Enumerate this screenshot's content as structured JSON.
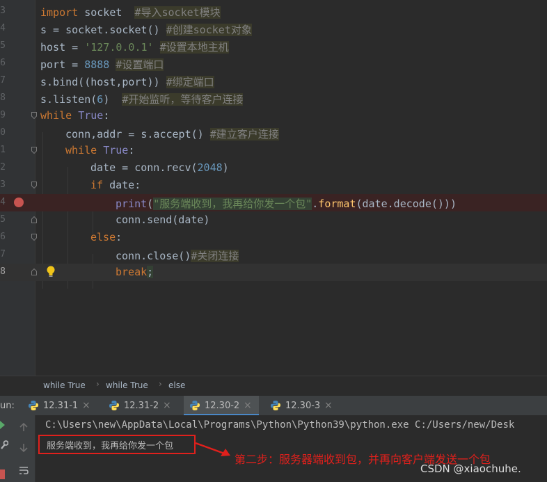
{
  "editor": {
    "lines": [
      {
        "num": "3"
      },
      {
        "num": "4"
      },
      {
        "num": "5"
      },
      {
        "num": "6"
      },
      {
        "num": "7"
      },
      {
        "num": "8"
      },
      {
        "num": "9"
      },
      {
        "num": "0"
      },
      {
        "num": "1"
      },
      {
        "num": "2"
      },
      {
        "num": "3"
      },
      {
        "num": "4"
      },
      {
        "num": "5"
      },
      {
        "num": "6"
      },
      {
        "num": "7"
      },
      {
        "num": "8"
      }
    ],
    "code": {
      "l1_kw": "import",
      "l1_rest": " socket  ",
      "l1_cmt": "#导入socket模块",
      "l2_rest": "s = socket.socket() ",
      "l2_cmt": "#创建socket对象",
      "l3_rest": "host = ",
      "l3_str": "'127.0.0.1'",
      "l3_cmt": "#设置本地主机",
      "l4_rest": "port = ",
      "l4_num": "8888",
      "l4_cmt": "#设置端口",
      "l5_rest": "s.bind((host,port)) ",
      "l5_cmt": "#绑定端口",
      "l6_a": "s.listen(",
      "l6_num": "6",
      "l6_b": ")  ",
      "l6_cmt": "#开始监听，等待客户连接",
      "l7_kw": "while",
      "l7_true": "True",
      "l7_colon": ":",
      "l8_rest": "conn,addr = s.accept() ",
      "l8_cmt": "#建立客户连接",
      "l9_kw": "while",
      "l9_true": "True",
      "l9_colon": ":",
      "l10_a": "date = conn.recv(",
      "l10_num": "2048",
      "l10_b": ")",
      "l11_kw": "if",
      "l11_rest": " date:",
      "l12_fn": "print",
      "l12_a": "(",
      "l12_str": "\"服务端收到，我再给你发一个包\"",
      "l12_b": ".",
      "l12_fmt": "format",
      "l12_c": "(date.decode()))",
      "l13_rest": "conn.send(date)",
      "l14_kw": "else",
      "l14_colon": ":",
      "l15_rest": "conn.close()",
      "l15_cmt": "#关闭连接",
      "l16_kw": "break",
      "l16_semi": ";"
    }
  },
  "breadcrumb": {
    "items": [
      "while True",
      "while True",
      "else"
    ],
    "sep": "›"
  },
  "run": {
    "label": "un:",
    "tabs": [
      {
        "label": "12.31-1",
        "close": "×"
      },
      {
        "label": "12.31-2",
        "close": "×"
      },
      {
        "label": "12.30-2",
        "close": "×"
      },
      {
        "label": "12.30-3",
        "close": "×"
      }
    ]
  },
  "console": {
    "cmd": "C:\\Users\\new\\AppData\\Local\\Programs\\Python\\Python39\\python.exe C:/Users/new/Desk",
    "output": "服务端收到，我再给你发一个包",
    "annotation": "第二步：服务器端收到包，并再向客户端发送一个包",
    "watermark": "CSDN @xiaochuhe."
  },
  "colors": {
    "accent": "#4a88c7",
    "breakpoint": "#c75450",
    "annotation": "#e0201c"
  }
}
